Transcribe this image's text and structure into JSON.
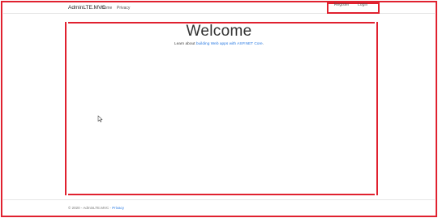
{
  "navbar": {
    "brand": "AdminLTE.MVC",
    "links": [
      "Home",
      "Privacy"
    ],
    "account": [
      "Register",
      "Login"
    ]
  },
  "main": {
    "title": "Welcome",
    "lead_prefix": "Learn about ",
    "lead_link": "building Web apps with ASP.NET Core",
    "lead_suffix": "."
  },
  "footer": {
    "copyright": "© 2020 - AdminLTE.MVC - ",
    "privacy_link": "Privacy"
  },
  "colors": {
    "highlight": "#e0212f",
    "link": "#2a7ae2"
  },
  "icons": [
    "mouse-cursor-icon"
  ]
}
